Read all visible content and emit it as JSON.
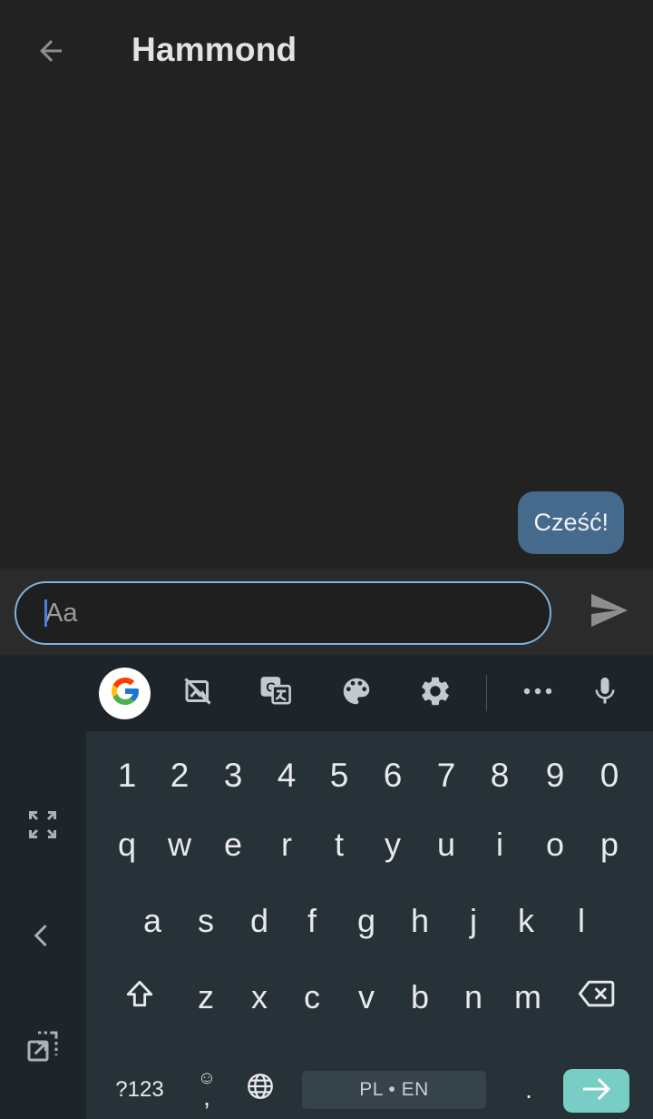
{
  "header": {
    "back_icon": "arrow-left-icon",
    "title": "Hammond"
  },
  "conversation": {
    "messages": [
      {
        "text": "Cześć!",
        "direction": "outgoing"
      }
    ]
  },
  "composer": {
    "placeholder": "Aa",
    "value": "",
    "send_icon": "send-icon"
  },
  "keyboard": {
    "toolbar": {
      "icons": [
        "google-icon",
        "image-off-icon",
        "translate-icon",
        "palette-icon",
        "gear-icon",
        "more-icon",
        "microphone-icon"
      ]
    },
    "rail_icons": [
      "expand-icon",
      "chevron-left-icon",
      "resize-icon"
    ],
    "rows": {
      "numbers": [
        "1",
        "2",
        "3",
        "4",
        "5",
        "6",
        "7",
        "8",
        "9",
        "0"
      ],
      "row1": [
        "q",
        "w",
        "e",
        "r",
        "t",
        "y",
        "u",
        "i",
        "o",
        "p"
      ],
      "row2": [
        "a",
        "s",
        "d",
        "f",
        "g",
        "h",
        "j",
        "k",
        "l"
      ],
      "row3": [
        "z",
        "x",
        "c",
        "v",
        "b",
        "n",
        "m"
      ]
    },
    "symbols_label": "?123",
    "comma": ",",
    "space_label": "PL • EN",
    "period": ".",
    "shift_icon": "shift-icon",
    "backspace_icon": "backspace-icon",
    "globe_icon": "globe-icon",
    "emoji_icon": "emoji-icon",
    "enter_icon": "arrow-right-icon"
  },
  "colors": {
    "background": "#222222",
    "bubble": "#456a8c",
    "input_border": "#7fb2dd",
    "keyboard_bg": "#263238",
    "enter_key": "#78cec4"
  }
}
